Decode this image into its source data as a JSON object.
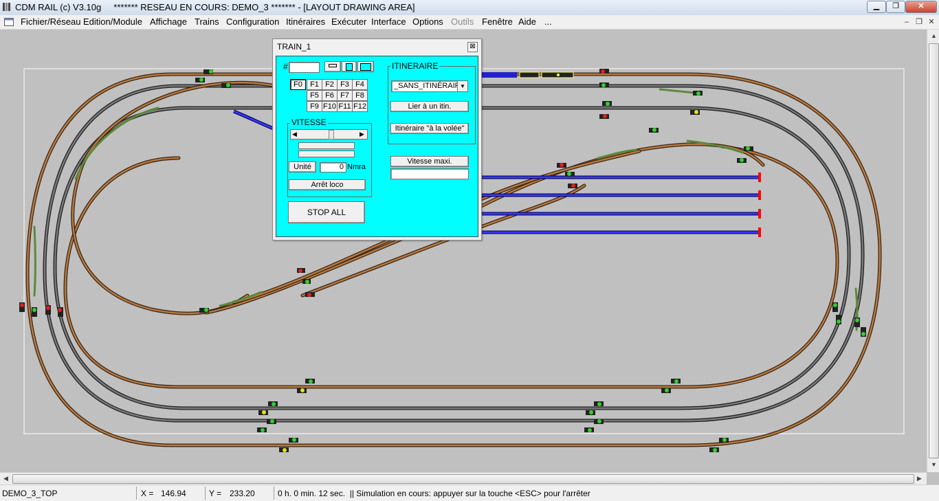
{
  "window": {
    "title": "CDM RAIL (c) V3.10g     ******* RESEAU EN COURS: DEMO_3 ******* - [LAYOUT DRAWING AREA]",
    "minimize_symbol": "▁",
    "maximize_symbol": "❐",
    "close_symbol": "✕"
  },
  "menu": {
    "items": [
      {
        "label": "Fichier/Réseau",
        "enabled": true
      },
      {
        "label": "Edition/Module",
        "enabled": true
      },
      {
        "label": "Affichage",
        "enabled": true
      },
      {
        "label": "Trains",
        "enabled": true
      },
      {
        "label": "Configuration",
        "enabled": true
      },
      {
        "label": "Itinéraires",
        "enabled": true
      },
      {
        "label": "Exécuter",
        "enabled": true
      },
      {
        "label": "Interface",
        "enabled": true
      },
      {
        "label": "Options",
        "enabled": true
      },
      {
        "label": "Outils",
        "enabled": false
      },
      {
        "label": "Fenêtre",
        "enabled": true
      },
      {
        "label": "Aide",
        "enabled": true
      },
      {
        "label": "...",
        "enabled": true
      }
    ],
    "mdi_minimize": "–",
    "mdi_restore": "❐",
    "mdi_close": "✕"
  },
  "train_window": {
    "title": "TRAIN_1",
    "close_symbol": "⊠",
    "number_label": "#",
    "number_value": "",
    "function_buttons": [
      "F0",
      "F1",
      "F2",
      "F3",
      "F4",
      "F5",
      "F6",
      "F7",
      "F8",
      "F9",
      "F10",
      "F11",
      "F12"
    ],
    "active_function": "F0",
    "vitesse": {
      "label": "VITESSE",
      "unit_button": "Unité",
      "speed_value": "0",
      "speed_unit": "Nmra",
      "stop_loco": "Arrêt loco"
    },
    "stop_all": "STOP ALL",
    "itineraire": {
      "label": "ITINERAIRE",
      "selected": "_SANS_ITINÉRAIRE",
      "link_button": "Lier à un itin.",
      "flyby_button": "Itinéraire \"à la volée\"",
      "vitesse_maxi": "Vitesse maxi.",
      "vitesse_maxi_value": ""
    }
  },
  "statusbar": {
    "layout": "DEMO_3_TOP",
    "x_label": "X =",
    "x_value": "146.94",
    "y_label": "Y =",
    "y_value": "233.20",
    "message": "0 h. 0 min. 12 sec.  || Simulation en cours: appuyer sur la touche <ESC> pour l'arrêter"
  },
  "colors": {
    "track_brown": "#9c6a3c",
    "track_gray": "#5a5a5a",
    "track_green": "#5a8a3c",
    "track_blue": "#2a2ac0",
    "panel_cyan": "#00ffff",
    "background": "#c0c0c0"
  }
}
